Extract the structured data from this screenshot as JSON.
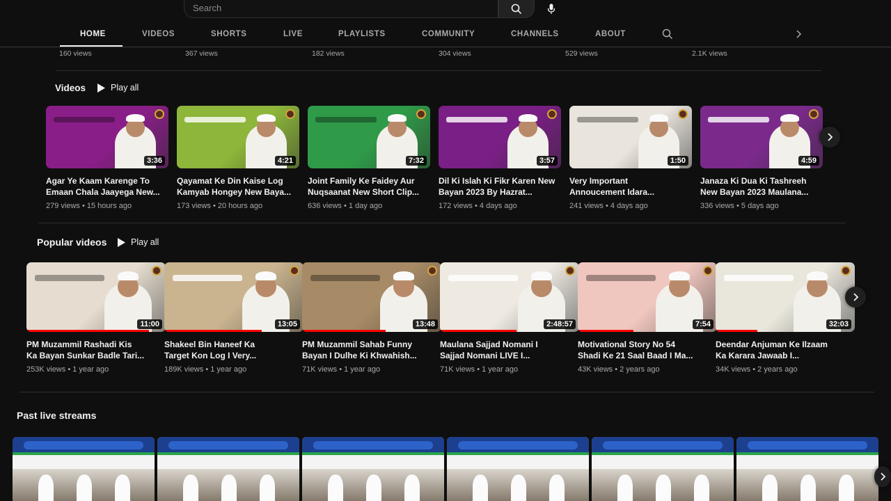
{
  "search": {
    "placeholder": "Search"
  },
  "tabs": [
    "HOME",
    "VIDEOS",
    "SHORTS",
    "LIVE",
    "PLAYLISTS",
    "COMMUNITY",
    "CHANNELS",
    "ABOUT"
  ],
  "active_tab": "HOME",
  "previous_row_views": [
    "160 views",
    "367 views",
    "182 views",
    "304 views",
    "529 views",
    "2.1K views"
  ],
  "sections": {
    "videos": {
      "title": "Videos",
      "play_all": "Play all",
      "items": [
        {
          "title": "Agar Ye Kaam Karenge To\nEmaan Chala Jaayega New...",
          "views": "279 views",
          "age": "15 hours ago",
          "duration": "3:36",
          "color": "#8a1e88"
        },
        {
          "title": "Qayamat Ke Din Kaise Log\nKamyab Hongey New Baya...",
          "views": "173 views",
          "age": "20 hours ago",
          "duration": "4:21",
          "color": "#8db63a"
        },
        {
          "title": "Joint Family Ke Faidey Aur\nNuqsaanat New Short Clip...",
          "views": "636 views",
          "age": "1 day ago",
          "duration": "7:32",
          "color": "#2f9a48"
        },
        {
          "title": "Dil Ki Islah Ki Fikr Karen New\nBayan 2023 By Hazrat...",
          "views": "172 views",
          "age": "4 days ago",
          "duration": "3:57",
          "color": "#7a1f85"
        },
        {
          "title": "Very Important\nAnnoucement Idara...",
          "views": "241 views",
          "age": "4 days ago",
          "duration": "1:50",
          "color": "#e9e4dc"
        },
        {
          "title": "Janaza Ki Dua Ki Tashreeh\nNew Bayan 2023 Maulana...",
          "views": "336 views",
          "age": "5 days ago",
          "duration": "4:59",
          "color": "#7b2a8c"
        }
      ]
    },
    "popular": {
      "title": "Popular videos",
      "play_all": "Play all",
      "items": [
        {
          "title": "PM Muzammil Rashadi Kis\nKa Bayan Sunkar Badle Tari...",
          "views": "253K views",
          "age": "1 year ago",
          "duration": "11:00",
          "color": "#e6ddd0"
        },
        {
          "title": "Shakeel Bin Haneef Ka\nTarget Kon Log I Very...",
          "views": "189K views",
          "age": "1 year ago",
          "duration": "13:05",
          "color": "#c9b48f"
        },
        {
          "title": "PM Muzammil Sahab Funny\nBayan I Dulhe Ki Khwahish...",
          "views": "71K views",
          "age": "1 year ago",
          "duration": "13:48",
          "color": "#a78b66"
        },
        {
          "title": "Maulana Sajjad Nomani I\nSajjad Nomani LIVE I...",
          "views": "71K views",
          "age": "1 year ago",
          "duration": "2:48:57",
          "color": "#eeeae2"
        },
        {
          "title": "Motivational Story No 54\nShadi Ke 21 Saal Baad I Ma...",
          "views": "43K views",
          "age": "2 years ago",
          "duration": "7:54",
          "color": "#f0c7bf"
        },
        {
          "title": "Deendar Anjuman Ke Ilzaam\nKa Karara Jawaab I...",
          "views": "34K views",
          "age": "2 years ago",
          "duration": "32:03",
          "color": "#e9e6dc"
        }
      ]
    },
    "live": {
      "title": "Past live streams",
      "count": 6
    }
  }
}
